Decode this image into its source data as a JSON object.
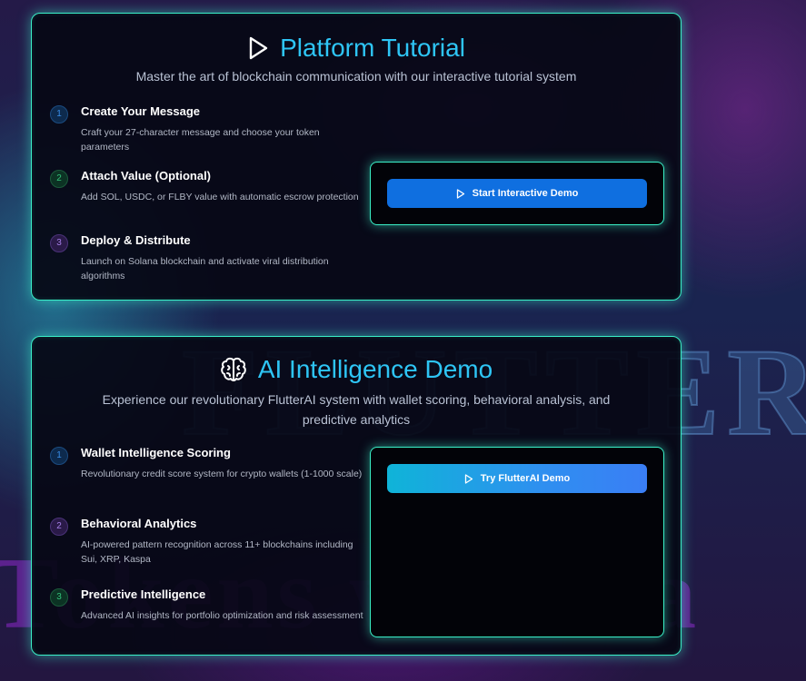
{
  "background": {
    "top_word": "FLUTTERB",
    "bottom_word": "Tokens with Ta"
  },
  "tutorial": {
    "title": "Platform Tutorial",
    "title_icon": "play-icon",
    "subtitle": "Master the art of blockchain communication with our interactive tutorial system",
    "steps": [
      {
        "num": "1",
        "title": "Create Your Message",
        "desc": "Craft your 27-character message and choose your token parameters"
      },
      {
        "num": "2",
        "title": "Attach Value (Optional)",
        "desc": "Add SOL, USDC, or FLBY value with automatic escrow protection"
      },
      {
        "num": "3",
        "title": "Deploy & Distribute",
        "desc": "Launch on Solana blockchain and activate viral distribution algorithms"
      }
    ],
    "button_label": "Start Interactive Demo",
    "button_icon": "play-icon"
  },
  "ai": {
    "title": "AI Intelligence Demo",
    "title_icon": "brain-icon",
    "subtitle": "Experience our revolutionary FlutterAI system with wallet scoring, behavioral analysis, and predictive analytics",
    "steps": [
      {
        "num": "1",
        "title": "Wallet Intelligence Scoring",
        "desc": "Revolutionary credit score system for crypto wallets (1-1000 scale)"
      },
      {
        "num": "2",
        "title": "Behavioral Analytics",
        "desc": "AI-powered pattern recognition across 11+ blockchains including Sui, XRP, Kaspa"
      },
      {
        "num": "3",
        "title": "Predictive Intelligence",
        "desc": "Advanced AI insights for portfolio optimization and risk assessment"
      }
    ],
    "button_label": "Try FlutterAI Demo",
    "button_icon": "play-icon"
  },
  "colors": {
    "accent_cyan": "#2ec5f5",
    "border_glow": "#3af0c8",
    "primary_button": "#0f6fe0"
  }
}
